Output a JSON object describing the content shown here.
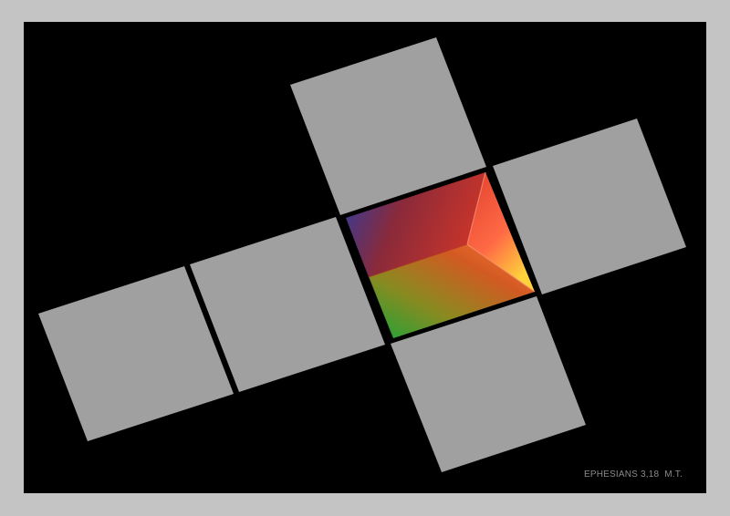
{
  "artwork": {
    "caption": "EPHESIANS 3,18  M.T.",
    "colors": {
      "outer_frame": "#c4c4c4",
      "background": "#000000",
      "panel": "#a0a0a0",
      "caption": "#8a8a8a",
      "center_red": "#c8342a",
      "center_orange": "#ff5a3c",
      "center_yellow": "#ffd23c",
      "center_green": "#1aa53a",
      "center_blue": "#2c3da0"
    }
  }
}
